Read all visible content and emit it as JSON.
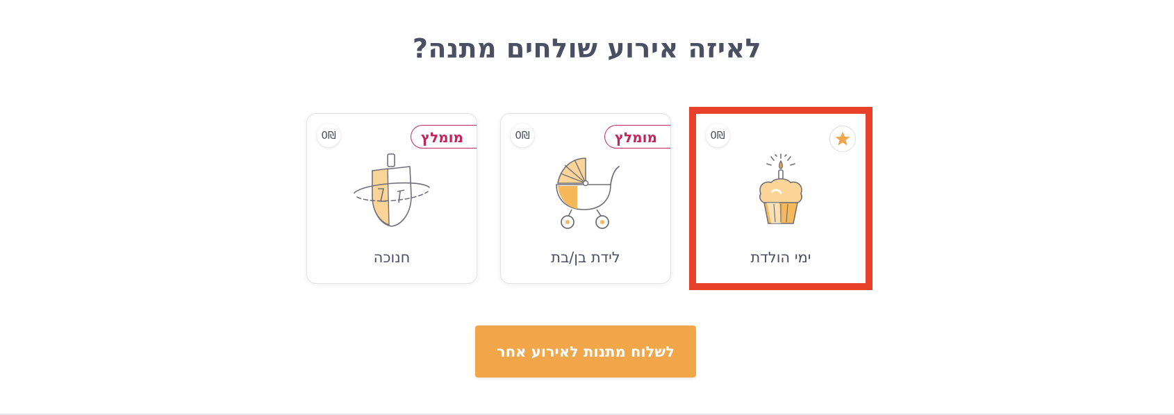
{
  "heading": "לאיזה אירוע שולחים מתנה?",
  "cards": [
    {
      "label": "ימי הולדת",
      "price": "0₪",
      "recommended": false,
      "favorite": true,
      "selected": true,
      "icon": "birthday-cupcake-icon"
    },
    {
      "label": "לידת בן/בת",
      "price": "0₪",
      "recommended": true,
      "recommended_label": "מומלץ",
      "favorite": false,
      "selected": false,
      "icon": "baby-stroller-icon"
    },
    {
      "label": "חנוכה",
      "price": "0₪",
      "recommended": true,
      "recommended_label": "מומלץ",
      "favorite": false,
      "selected": false,
      "icon": "dreidel-icon"
    }
  ],
  "cta_label": "לשלוח מתנות לאירוע אחר",
  "colors": {
    "accent": "#f2a64a",
    "recommended": "#c4245a",
    "selection": "#e8412a",
    "text": "#4a4f61"
  }
}
